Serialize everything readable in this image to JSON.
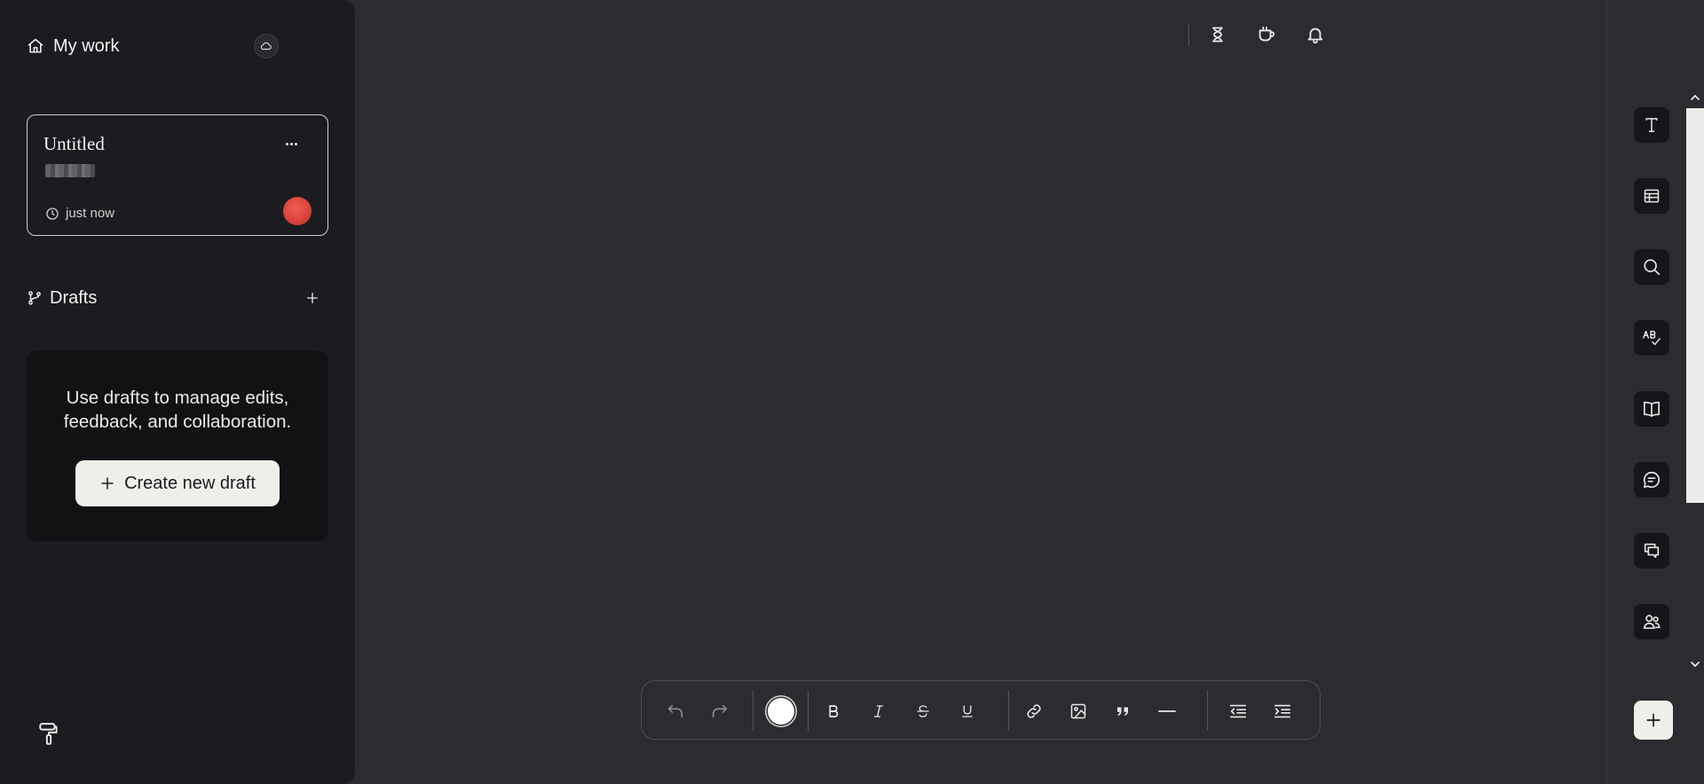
{
  "sidebar": {
    "my_work_label": "My work",
    "home_icon": "home-icon",
    "cloud_icon": "cloud-icon",
    "document_card": {
      "title": "Untitled",
      "timestamp": "just now",
      "more_icon": "more-horizontal-icon",
      "clock_icon": "clock-icon",
      "avatar_color": "#e0473d"
    },
    "drafts": {
      "label": "Drafts",
      "icon": "git-branch-icon",
      "add_icon": "plus-icon",
      "empty_message_line1": "Use drafts to manage edits,",
      "empty_message_line2": "feedback, and collaboration.",
      "create_button_label": "Create new draft"
    },
    "paint_icon": "paint-roller-icon"
  },
  "top_bar": {
    "icons": [
      "hourglass-icon",
      "coffee-icon",
      "bell-icon"
    ]
  },
  "right_rail": {
    "tools": [
      "text-icon",
      "table-icon",
      "search-icon",
      "spellcheck-icon",
      "book-icon",
      "comment-icon",
      "comments-icon",
      "users-icon"
    ],
    "add_icon": "plus-icon"
  },
  "toolbar": {
    "buttons": [
      "undo-icon",
      "redo-icon",
      "text-color",
      "bold-icon",
      "italic-icon",
      "strikethrough-icon",
      "underline-icon",
      "link-icon",
      "image-icon",
      "quote-icon",
      "horizontal-rule-icon",
      "outdent-icon",
      "indent-icon"
    ],
    "text_color": "#ffffff"
  },
  "colors": {
    "background": "#2b2c30",
    "sidebar": "#1b1c1f",
    "accent_button": "#efeee9"
  }
}
